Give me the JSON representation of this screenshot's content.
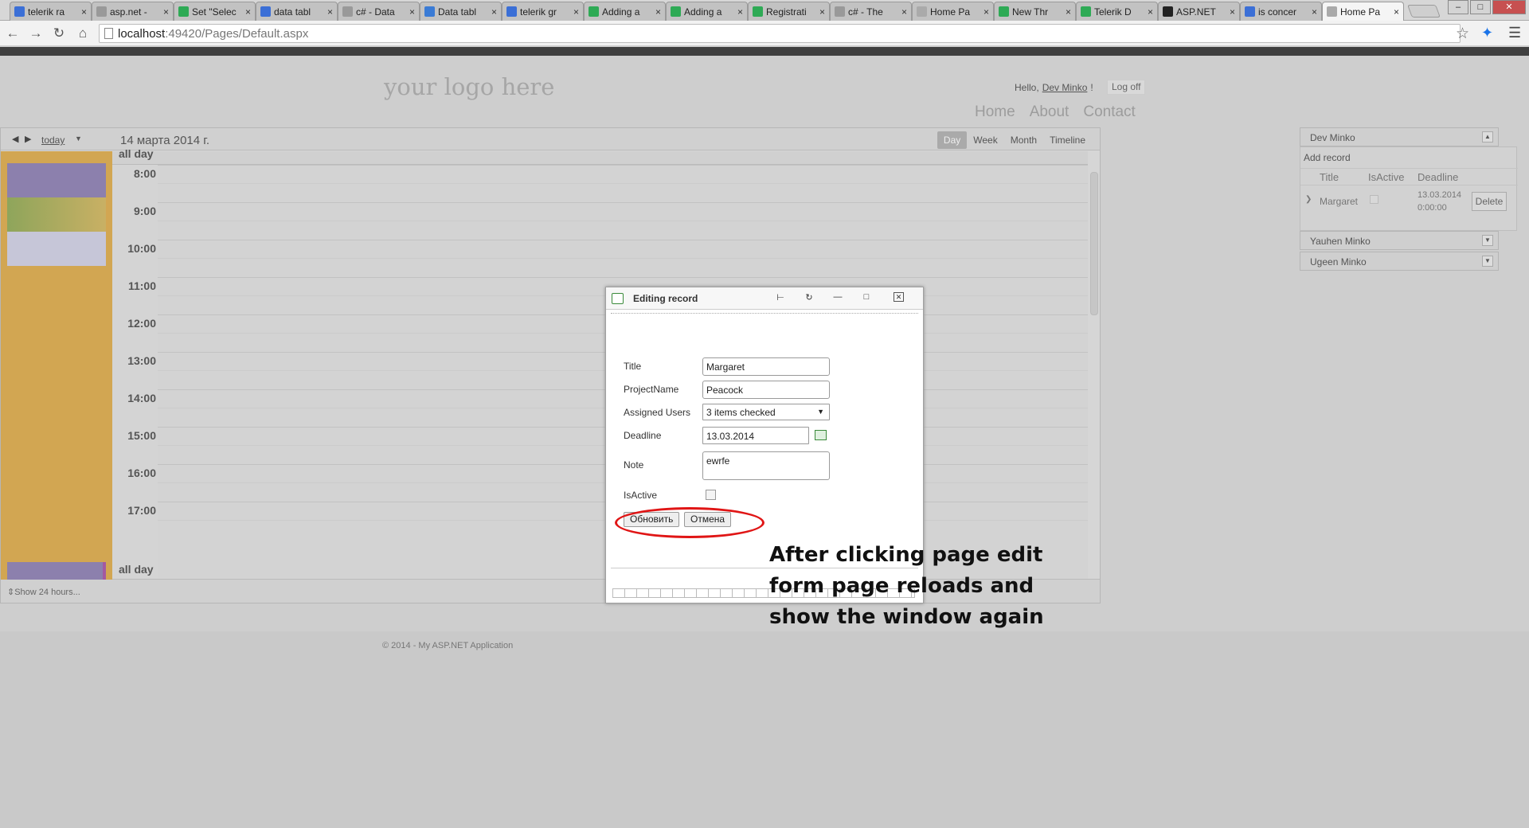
{
  "browser": {
    "tabs": [
      {
        "title": "telerik ra",
        "favicon": "google-icon",
        "color": "#3b6fd6"
      },
      {
        "title": "asp.net -",
        "favicon": "stackoverflow-icon",
        "color": "#999999"
      },
      {
        "title": "Set \"Selec",
        "favicon": "telerik-icon",
        "color": "#2eaa55"
      },
      {
        "title": "data tabl",
        "favicon": "google-icon",
        "color": "#3b6fd6"
      },
      {
        "title": "c# - Data",
        "favicon": "stackoverflow-icon",
        "color": "#999999"
      },
      {
        "title": "Data tabl",
        "favicon": "bing-icon",
        "color": "#3a7bd5"
      },
      {
        "title": "telerik gr",
        "favicon": "google-icon",
        "color": "#3b6fd6"
      },
      {
        "title": "Adding a",
        "favicon": "telerik-icon",
        "color": "#2eaa55"
      },
      {
        "title": "Adding a",
        "favicon": "telerik-icon",
        "color": "#2eaa55"
      },
      {
        "title": "Registrati",
        "favicon": "telerik-icon",
        "color": "#2eaa55"
      },
      {
        "title": "c# - The",
        "favicon": "stackoverflow-icon",
        "color": "#999999"
      },
      {
        "title": "Home Pa",
        "favicon": "page-icon",
        "color": "#aaaaaa"
      },
      {
        "title": "New Thr",
        "favicon": "telerik-icon",
        "color": "#2eaa55"
      },
      {
        "title": "Telerik D",
        "favicon": "telerik-icon",
        "color": "#2eaa55"
      },
      {
        "title": "ASP.NET",
        "favicon": "aspnet-icon",
        "color": "#222222"
      },
      {
        "title": "is concer",
        "favicon": "google-icon",
        "color": "#3b6fd6"
      },
      {
        "title": "Home Pa",
        "favicon": "page-icon",
        "color": "#aaaaaa"
      }
    ],
    "url_host": "localhost",
    "url_path": ":49420/Pages/Default.aspx"
  },
  "site": {
    "logo": "your logo here",
    "hello": "Hello,",
    "user": "Dev Minko",
    "exclam": "!",
    "logoff": "Log off",
    "nav": [
      "Home",
      "About",
      "Contact"
    ],
    "copyright": "© 2014 - My ASP.NET Application"
  },
  "scheduler": {
    "today": "today",
    "date": "14 марта 2014 г.",
    "views": [
      "Day",
      "Week",
      "Month",
      "Timeline"
    ],
    "selected_view": "Day",
    "all_day": "all day",
    "hours": [
      "8:00",
      "9:00",
      "10:00",
      "11:00",
      "12:00",
      "13:00",
      "14:00",
      "15:00",
      "16:00",
      "17:00"
    ],
    "show24": "Show 24 hours..."
  },
  "panel": {
    "users": [
      "Dev Minko",
      "Yauhen Minko",
      "Ugeen Minko"
    ],
    "add_record": "Add record",
    "columns": [
      "Title",
      "IsActive",
      "Deadline"
    ],
    "row": {
      "title": "Margaret",
      "deadline_date": "13.03.2014",
      "deadline_time": "0:00:00"
    },
    "delete": "Delete"
  },
  "dialog": {
    "title": "Editing record",
    "labels": [
      "Title",
      "ProjectName",
      "Assigned Users",
      "Deadline",
      "Note",
      "IsActive"
    ],
    "title_value": "Margaret",
    "project_value": "Peacock",
    "users_value": "3 items checked",
    "deadline_value": "13.03.2014",
    "note_value": "ewrfe",
    "update_button": "Обновить",
    "cancel_button": "Отмена"
  },
  "annotation": {
    "lines": [
      "After clicking page edit",
      "form page reloads and",
      "show the window again"
    ],
    "color": "#e01515"
  }
}
